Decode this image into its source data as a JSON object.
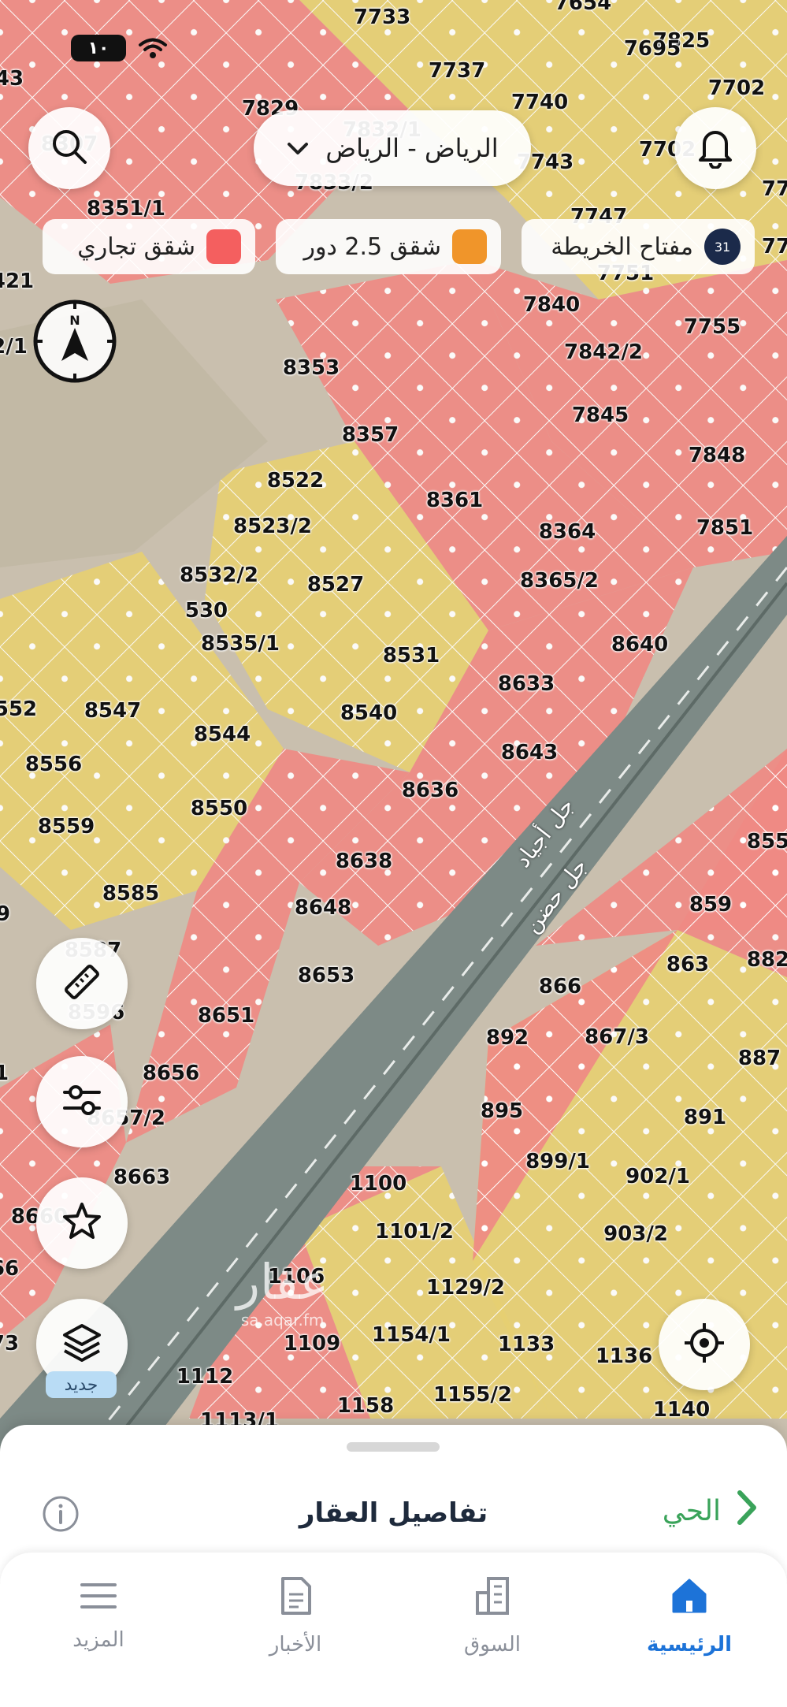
{
  "status_bar": {
    "battery": "١٠"
  },
  "top": {
    "city": "الرياض - الرياض"
  },
  "legend": {
    "commercial": "شقق تجاري",
    "apartments": "شقق 2.5 دور",
    "map_key": "مفتاح الخريطة",
    "map_key_badge": "31"
  },
  "compass_letter": "N",
  "new_badge": "جديد",
  "watermark": {
    "brand": "عقار",
    "url": "sa.aqar.fm"
  },
  "roads": [
    "جل أجياد",
    "جل حضن"
  ],
  "plots": {
    "labels": [
      "7733",
      "7654",
      "7825",
      "7695",
      "43",
      "7737",
      "7702",
      "7829",
      "7740",
      "7832/1",
      "8307",
      "7743",
      "7833/2",
      "7702",
      "77",
      "7747",
      "8351/1",
      "77",
      "7751",
      "421",
      "7840",
      "7755",
      "2/1",
      "7842/2",
      "8353",
      "7845",
      "8357",
      "7848",
      "8522",
      "8361",
      "7851",
      "8364",
      "8523/2",
      "8532/2",
      "8527",
      "8365/2",
      "530",
      "8535/1",
      "8640",
      "8531",
      "552",
      "8547",
      "8633",
      "8540",
      "8544",
      "8643",
      "8556",
      "8636",
      "8550",
      "8559",
      "855",
      "8638",
      "8585",
      "8648",
      "859",
      "8587",
      "863",
      "882",
      "8653",
      "866",
      "8596",
      "8651",
      "892",
      "867/3",
      "887",
      "8656",
      "895",
      "891",
      "8657/2",
      "899/1",
      "902/1",
      "8663",
      "1100",
      "8660",
      "1101/2",
      "903/2",
      "1106",
      "66",
      "1129/2",
      "1109",
      "1154/1",
      "1133",
      "1136",
      "73",
      "1112",
      "1155/2",
      "1158",
      "1140",
      "1113/1",
      "9",
      "1"
    ],
    "zoning": [
      "commercial",
      "unknown",
      "unknown",
      "unknown",
      "commercial",
      "commercial",
      "unknown",
      "commercial",
      "apartments",
      "commercial",
      "commercial",
      "commercial",
      "commercial",
      "unknown",
      "unknown",
      "commercial",
      "commercial",
      "unknown",
      "commercial",
      "unknown",
      "commercial",
      "commercial",
      "unknown",
      "commercial",
      "commercial",
      "commercial",
      "commercial",
      "commercial",
      "apartments",
      "commercial",
      "commercial",
      "commercial",
      "apartments",
      "unknown",
      "apartments",
      "commercial",
      "unknown",
      "apartments",
      "commercial",
      "commercial",
      "apartments",
      "apartments",
      "commercial",
      "apartments",
      "apartments",
      "commercial",
      "apartments",
      "commercial",
      "apartments",
      "apartments",
      "commercial",
      "commercial",
      "apartments",
      "commercial",
      "commercial",
      "apartments",
      "commercial",
      "apartments",
      "commercial",
      "commercial",
      "apartments",
      "commercial",
      "commercial",
      "apartments",
      "apartments",
      "commercial",
      "commercial",
      "apartments",
      "commercial",
      "apartments",
      "apartments",
      "commercial",
      "commercial",
      "commercial",
      "apartments",
      "apartments",
      "commercial",
      "commercial",
      "apartments",
      "apartments",
      "apartments",
      "apartments",
      "apartments",
      "commercial",
      "commercial",
      "apartments",
      "apartments",
      "apartments",
      "commercial",
      "unknown",
      "unknown"
    ]
  },
  "sheet": {
    "title": "تفاصيل العقار",
    "link": "الحي"
  },
  "nav": {
    "home": "الرئيسية",
    "market": "السوق",
    "news": "الأخبار",
    "more": "المزيد"
  },
  "colors": {
    "commercial": "#f07c78",
    "apartments": "#e9cf6e",
    "accent": "#1d73d8",
    "link": "#3aa35a"
  }
}
